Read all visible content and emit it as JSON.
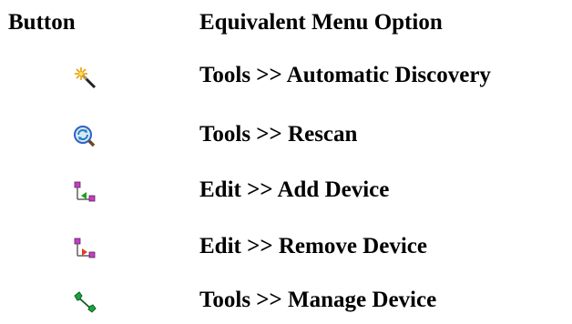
{
  "header": {
    "button_col": "Button",
    "menu_col": "Equivalent Menu Option"
  },
  "rows": [
    {
      "icon": "magic-wand-icon",
      "label": "Tools >> Automatic Discovery"
    },
    {
      "icon": "rescan-icon",
      "label": "Tools >> Rescan"
    },
    {
      "icon": "add-device-icon",
      "label": "Edit >> Add Device"
    },
    {
      "icon": "remove-device-icon",
      "label": "Edit >> Remove Device"
    },
    {
      "icon": "wrench-icon",
      "label": "Tools >> Manage Device"
    }
  ],
  "colors": {
    "text": "#000000",
    "purple": "#c040c0",
    "green": "#20a020",
    "red": "#e04020",
    "wrench": "#20a040",
    "rescan": "#3060c0"
  }
}
